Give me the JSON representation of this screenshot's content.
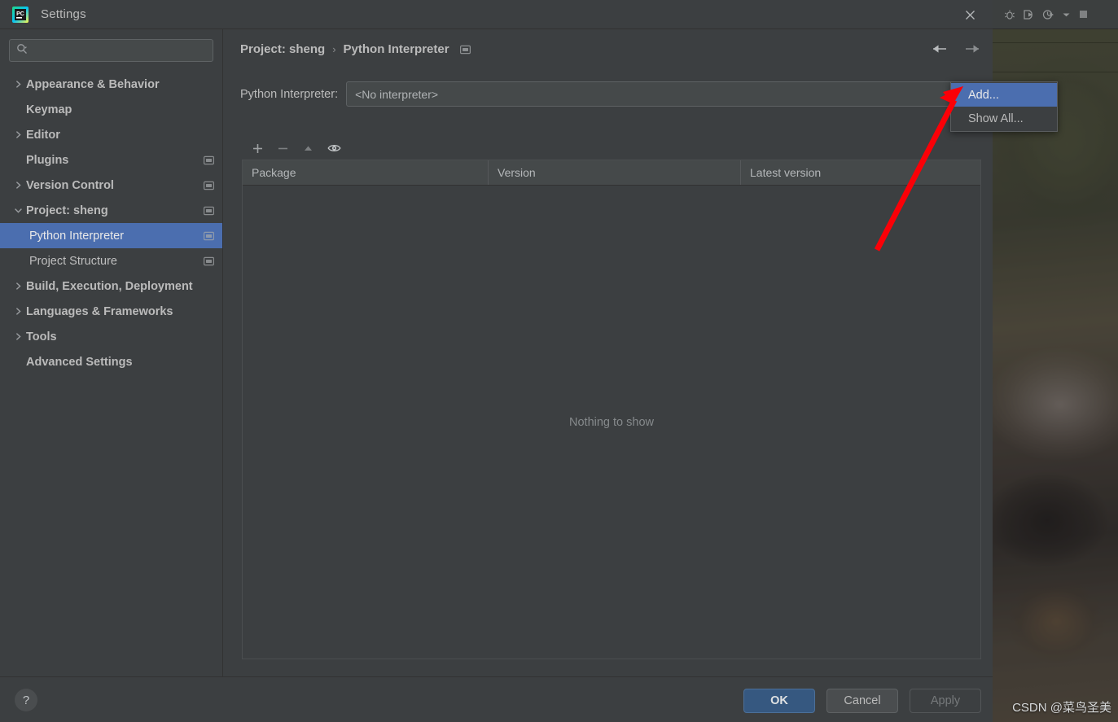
{
  "window": {
    "title": "Settings",
    "app_icon": "pycharm-icon",
    "close_icon": "close-icon"
  },
  "search": {
    "placeholder": "",
    "value": "",
    "icon": "search-icon"
  },
  "sidebar": {
    "items": [
      {
        "label": "Appearance & Behavior",
        "level": "top",
        "chevron": "chevron-right-icon",
        "badge": false,
        "selected": false
      },
      {
        "label": "Keymap",
        "level": "top",
        "chevron": "none",
        "badge": false,
        "selected": false
      },
      {
        "label": "Editor",
        "level": "top",
        "chevron": "chevron-right-icon",
        "badge": false,
        "selected": false
      },
      {
        "label": "Plugins",
        "level": "top",
        "chevron": "none",
        "badge": true,
        "selected": false
      },
      {
        "label": "Version Control",
        "level": "top",
        "chevron": "chevron-right-icon",
        "badge": true,
        "selected": false
      },
      {
        "label": "Project: sheng",
        "level": "top",
        "chevron": "chevron-down-icon",
        "badge": true,
        "selected": false
      },
      {
        "label": "Python Interpreter",
        "level": "child",
        "chevron": "none",
        "badge": true,
        "selected": true
      },
      {
        "label": "Project Structure",
        "level": "child",
        "chevron": "none",
        "badge": true,
        "selected": false
      },
      {
        "label": "Build, Execution, Deployment",
        "level": "top",
        "chevron": "chevron-right-icon",
        "badge": false,
        "selected": false
      },
      {
        "label": "Languages & Frameworks",
        "level": "top",
        "chevron": "chevron-right-icon",
        "badge": false,
        "selected": false
      },
      {
        "label": "Tools",
        "level": "top",
        "chevron": "chevron-right-icon",
        "badge": false,
        "selected": false
      },
      {
        "label": "Advanced Settings",
        "level": "top",
        "chevron": "none",
        "badge": false,
        "selected": false
      }
    ]
  },
  "breadcrumb": {
    "root": "Project: sheng",
    "separator": "›",
    "current": "Python Interpreter",
    "badge_icon": "project-scope-icon"
  },
  "nav": {
    "back_icon": "arrow-left-icon",
    "forward_icon": "arrow-right-icon"
  },
  "interpreter": {
    "label": "Python Interpreter:",
    "value": "<No interpreter>",
    "dropdown_icon": "chevron-down-icon"
  },
  "popup": {
    "items": [
      {
        "label": "Add...",
        "highlighted": true
      },
      {
        "label": "Show All...",
        "highlighted": false
      }
    ]
  },
  "package_toolbar": {
    "add_icon": "plus-icon",
    "remove_icon": "minus-icon",
    "upgrade_icon": "triangle-up-icon",
    "show_early_icon": "eye-icon"
  },
  "package_table": {
    "columns": [
      "Package",
      "Version",
      "Latest version"
    ],
    "rows": [],
    "empty_text": "Nothing to show"
  },
  "footer": {
    "help_label": "?",
    "ok_label": "OK",
    "cancel_label": "Cancel",
    "apply_label": "Apply"
  },
  "ide_toolbar": {
    "icons": [
      "debug-icon",
      "run-with-coverage-icon",
      "profile-icon",
      "chevron-down-icon",
      "stop-icon"
    ]
  },
  "annotation": {
    "arrow_color": "#fb0007",
    "points_to": "Add..."
  },
  "watermark": {
    "text": "CSDN @菜鸟圣美"
  },
  "colors": {
    "panel_bg": "#3c3f41",
    "selection_blue": "#4b6eaf",
    "primary_button": "#365880",
    "text": "#bbbbbb",
    "muted_text": "#868a8c"
  }
}
